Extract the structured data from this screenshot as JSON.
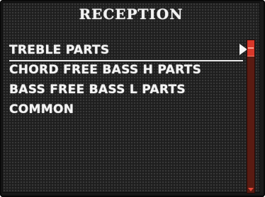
{
  "screen": {
    "title": "RECEPTION",
    "selected_index": 0,
    "selection_marker_icon": "triangle-right-icon",
    "scroll_position": 0.0
  },
  "menu": {
    "items": [
      {
        "label": "TREBLE PARTS"
      },
      {
        "label": "CHORD FREE BASS H PARTS"
      },
      {
        "label": "BASS FREE BASS L PARTS"
      },
      {
        "label": "COMMON"
      }
    ]
  },
  "colors": {
    "text": "#f4f4f4",
    "background": "#1e1e1e",
    "scrollbar_track": "#5a1b12",
    "scrollbar_thumb": "#d8382a"
  }
}
